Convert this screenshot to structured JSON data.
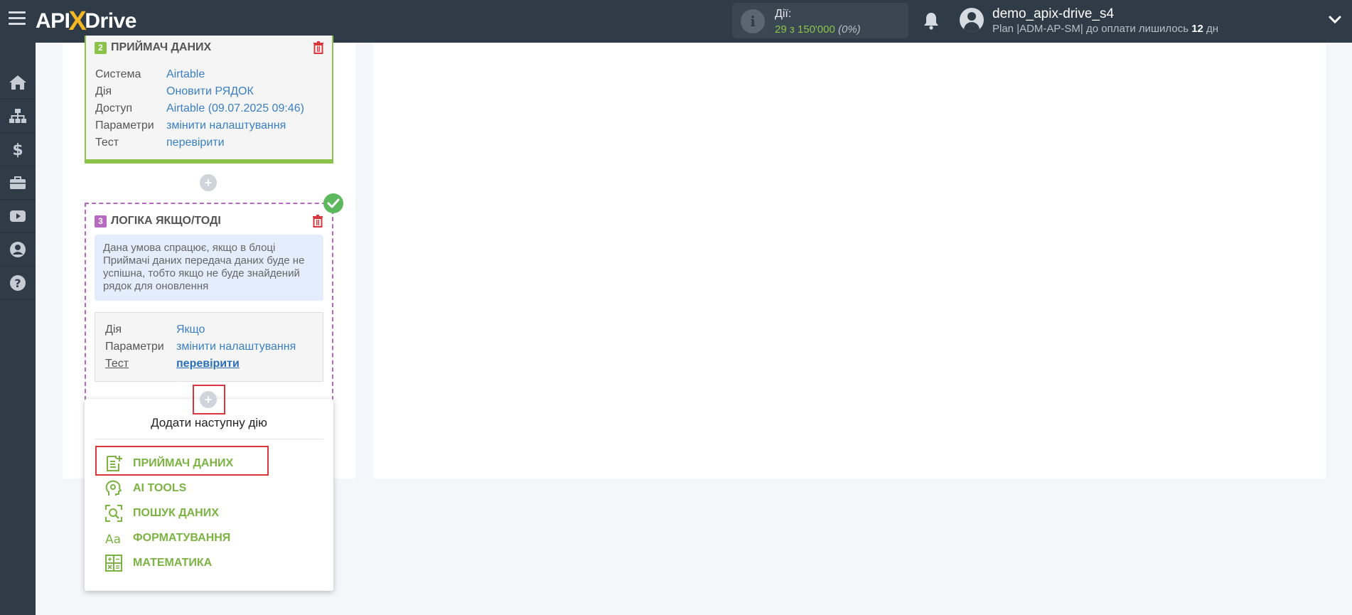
{
  "brand": {
    "logo_api": "API",
    "logo_x": "X",
    "logo_drive": "Drive",
    "accent_color": "#8bc34a",
    "topbar_color": "#2f3b47"
  },
  "header": {
    "actions_label": "Дії:",
    "actions_used": "29",
    "actions_sep": " з ",
    "actions_total": "150'000",
    "actions_pct": "(0%)",
    "user_name": "demo_apix-drive_s4",
    "plan_text": "Plan |ADM-AP-SM| до оплати лишилось ",
    "plan_days": "12",
    "plan_days_unit": " дн"
  },
  "sidebar": {
    "items": [
      {
        "icon": "home-icon"
      },
      {
        "icon": "sitemap-icon"
      },
      {
        "icon": "dollar-icon"
      },
      {
        "icon": "briefcase-icon"
      },
      {
        "icon": "video-icon"
      },
      {
        "icon": "user-circle-icon"
      },
      {
        "icon": "help-icon"
      }
    ]
  },
  "block2": {
    "number": "2",
    "title": "ПРИЙМАЧ ДАНИХ",
    "badge_color": "#8bc34a",
    "rows": [
      {
        "key": "Система",
        "value": "Airtable"
      },
      {
        "key": "Дія",
        "value": "Оновити РЯДОК"
      },
      {
        "key": "Доступ",
        "value": "Airtable (09.07.2025 09:46)"
      },
      {
        "key": "Параметри",
        "value": "змінити налаштування"
      },
      {
        "key": "Тест",
        "value": "перевірити"
      }
    ]
  },
  "block3": {
    "number": "3",
    "title": "ЛОГІКА ЯКЩО/ТОДІ",
    "badge_color": "#b769c2",
    "note": "Дана умова спрацює, якщо в блоці Приймачі даних передача даних буде не успішна, тобто якщо не буде знайдений рядок для оновлення",
    "rows": [
      {
        "key": "Дія",
        "value": "Якщо"
      },
      {
        "key": "Параметри",
        "value": "змінити налаштування"
      },
      {
        "key": "Тест",
        "value": "перевірити"
      }
    ]
  },
  "add_step": {
    "plus": "+",
    "title": "Додати наступну дію",
    "items": [
      {
        "label": "ПРИЙМАЧ ДАНИХ",
        "icon": "data-receiver-icon"
      },
      {
        "label": "AI TOOLS",
        "icon": "ai-tools-icon"
      },
      {
        "label": "ПОШУК ДАНИХ",
        "icon": "data-search-icon"
      },
      {
        "label": "ФОРМАТУВАННЯ",
        "icon": "formatting-icon"
      },
      {
        "label": "МАТЕМАТИКА",
        "icon": "math-icon"
      }
    ]
  }
}
